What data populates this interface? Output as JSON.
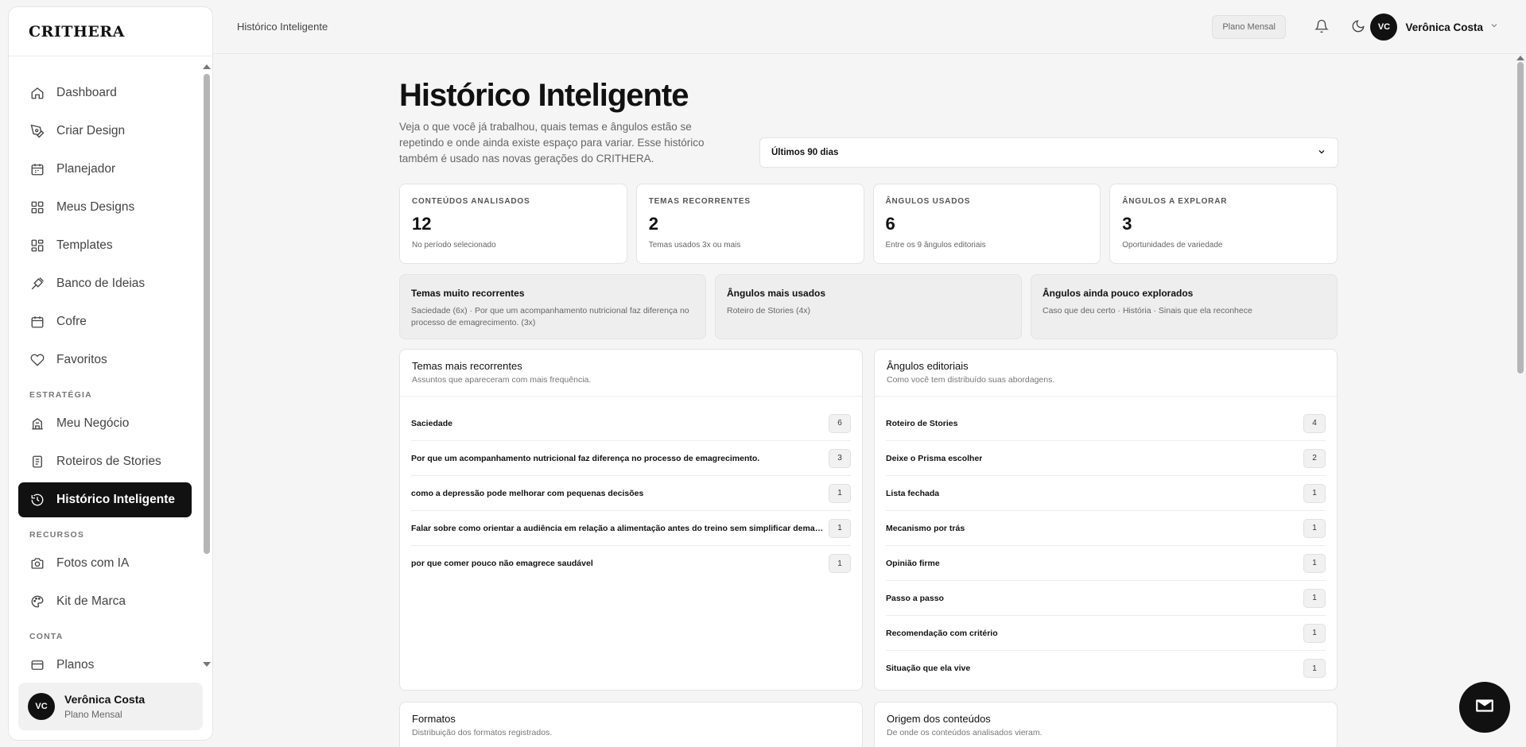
{
  "brand": "CRITHERA",
  "sidebar": {
    "items": [
      {
        "label": "Dashboard"
      },
      {
        "label": "Criar Design"
      },
      {
        "label": "Planejador"
      },
      {
        "label": "Meus Designs"
      },
      {
        "label": "Templates"
      },
      {
        "label": "Banco de Ideias"
      },
      {
        "label": "Cofre"
      },
      {
        "label": "Favoritos"
      }
    ],
    "section_estrategia": "ESTRATÉGIA",
    "estrategia_items": [
      {
        "label": "Meu Negócio"
      },
      {
        "label": "Roteiros de Stories"
      },
      {
        "label": "Histórico Inteligente"
      }
    ],
    "section_recursos": "RECURSOS",
    "recursos_items": [
      {
        "label": "Fotos com IA"
      },
      {
        "label": "Kit de Marca"
      }
    ],
    "section_conta": "CONTA",
    "conta_items": [
      {
        "label": "Planos"
      }
    ],
    "user": {
      "initials": "VC",
      "name": "Verônica Costa",
      "plan": "Plano Mensal"
    }
  },
  "topbar": {
    "breadcrumb": "Histórico Inteligente",
    "plan_badge": "Plano Mensal",
    "user_initials": "VC",
    "user_name": "Verônica Costa"
  },
  "page": {
    "title": "Histórico Inteligente",
    "description": "Veja o que você já trabalhou, quais temas e ângulos estão se repetindo e onde ainda existe espaço para variar. Esse histórico também é usado nas novas gerações do CRITHERA.",
    "period_selected": "Últimos 90 dias"
  },
  "stats": [
    {
      "label": "CONTEÚDOS ANALISADOS",
      "value": "12",
      "sub": "No período selecionado"
    },
    {
      "label": "TEMAS RECORRENTES",
      "value": "2",
      "sub": "Temas usados 3x ou mais"
    },
    {
      "label": "ÂNGULOS USADOS",
      "value": "6",
      "sub": "Entre os 9 ângulos editoriais"
    },
    {
      "label": "ÂNGULOS A EXPLORAR",
      "value": "3",
      "sub": "Oportunidades de variedade"
    }
  ],
  "insights": [
    {
      "title": "Temas muito recorrentes",
      "text": "Saciedade (6x) · Por que um acompanhamento nutricional faz diferença no processo de emagrecimento. (3x)"
    },
    {
      "title": "Ângulos mais usados",
      "text": "Roteiro de Stories (4x)"
    },
    {
      "title": "Ângulos ainda pouco explorados",
      "text": "Caso que deu certo · História · Sinais que ela reconhece"
    }
  ],
  "themes_panel": {
    "title": "Temas mais recorrentes",
    "subtitle": "Assuntos que apareceram com mais frequência.",
    "rows": [
      {
        "label": "Saciedade",
        "count": "6"
      },
      {
        "label": "Por que um acompanhamento nutricional faz diferença no processo de emagrecimento.",
        "count": "3"
      },
      {
        "label": "como a depressão pode melhorar com pequenas decisões",
        "count": "1"
      },
      {
        "label": "Falar sobre como orientar a audiência em relação a alimentação antes do treino sem simplificar demais o…",
        "count": "1"
      },
      {
        "label": "por que comer pouco não emagrece saudável",
        "count": "1"
      }
    ]
  },
  "angles_panel": {
    "title": "Ângulos editoriais",
    "subtitle": "Como você tem distribuído suas abordagens.",
    "rows": [
      {
        "label": "Roteiro de Stories",
        "count": "4"
      },
      {
        "label": "Deixe o Prisma escolher",
        "count": "2"
      },
      {
        "label": "Lista fechada",
        "count": "1"
      },
      {
        "label": "Mecanismo por trás",
        "count": "1"
      },
      {
        "label": "Opinião firme",
        "count": "1"
      },
      {
        "label": "Passo a passo",
        "count": "1"
      },
      {
        "label": "Recomendação com critério",
        "count": "1"
      },
      {
        "label": "Situação que ela vive",
        "count": "1"
      }
    ]
  },
  "formats_panel": {
    "title": "Formatos",
    "subtitle": "Distribuição dos formatos registrados."
  },
  "origin_panel": {
    "title": "Origem dos conteúdos",
    "subtitle": "De onde os conteúdos analisados vieram."
  }
}
